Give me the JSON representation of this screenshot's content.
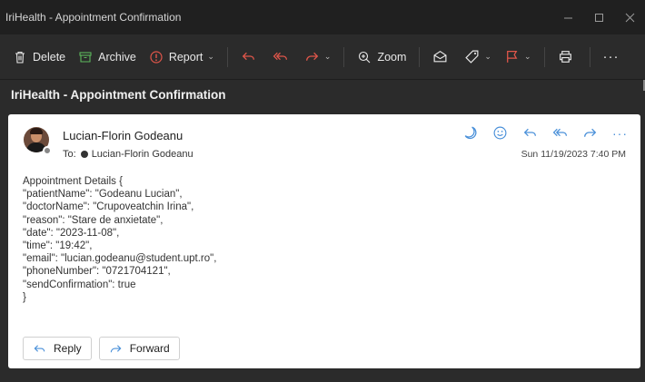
{
  "window": {
    "title": "IriHealth - Appointment Confirmation"
  },
  "toolbar": {
    "delete_label": "Delete",
    "archive_label": "Archive",
    "report_label": "Report",
    "zoom_label": "Zoom",
    "more_label": "···"
  },
  "message": {
    "subject": "IriHealth - Appointment Confirmation",
    "sender_name": "Lucian-Florin Godeanu",
    "to_prefix": "To:",
    "to_name": "Lucian-Florin Godeanu",
    "date": "Sun 11/19/2023 7:40 PM",
    "more_label": "···",
    "body_lines": [
      "Appointment Details {",
      "\"patientName\": \"Godeanu Lucian\",",
      "\"doctorName\": \"Crupoveatchin Irina\",",
      "\"reason\": \"Stare de anxietate\",",
      "\"date\": \"2023-11-08\",",
      "\"time\": \"19:42\",",
      "\"email\": \"lucian.godeanu@student.upt.ro\",",
      "\"phoneNumber\": \"0721704121\",",
      "\"sendConfirmation\": true",
      "}"
    ]
  },
  "actions": {
    "reply_label": "Reply",
    "forward_label": "Forward"
  },
  "colors": {
    "accent": "#4a90d9",
    "report": "#e0564a",
    "flag": "#e0564a",
    "archive": "#5cb85c"
  }
}
